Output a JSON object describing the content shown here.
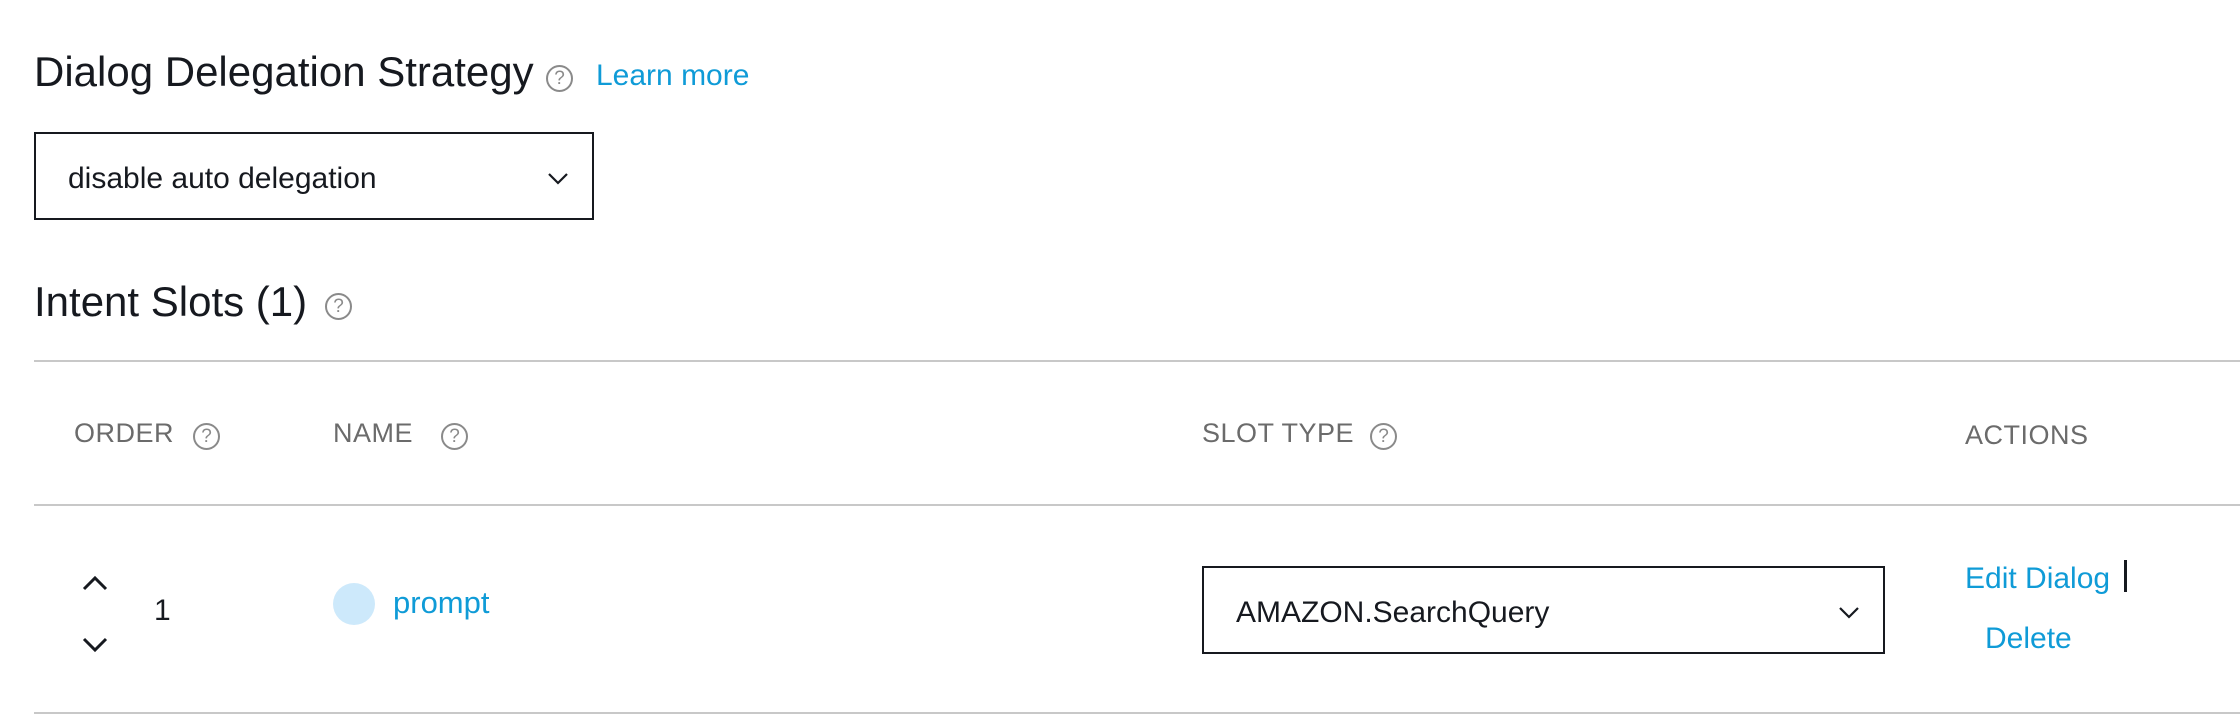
{
  "delegation": {
    "title": "Dialog Delegation Strategy",
    "help_glyph": "?",
    "learn_more": "Learn more",
    "selected_value": "disable auto delegation"
  },
  "slots": {
    "title": "Intent Slots (1)",
    "help_glyph": "?",
    "columns": {
      "order": "ORDER",
      "name": "NAME",
      "slot_type": "SLOT TYPE",
      "actions": "ACTIONS"
    },
    "rows": [
      {
        "order": "1",
        "name": "prompt",
        "slot_type": "AMAZON.SearchQuery",
        "edit_label": "Edit Dialog",
        "delete_label": "Delete"
      }
    ]
  },
  "icons": {
    "help": "question-circle-icon",
    "dropdown": "chevron-down-icon",
    "move_up": "chevron-up-icon",
    "move_down": "chevron-down-icon"
  },
  "colors": {
    "link": "#0f9bd7",
    "text": "#16191f",
    "muted": "#6b6b6b",
    "rule": "#c8c8c8",
    "slot_dot": "#cde9fb"
  }
}
